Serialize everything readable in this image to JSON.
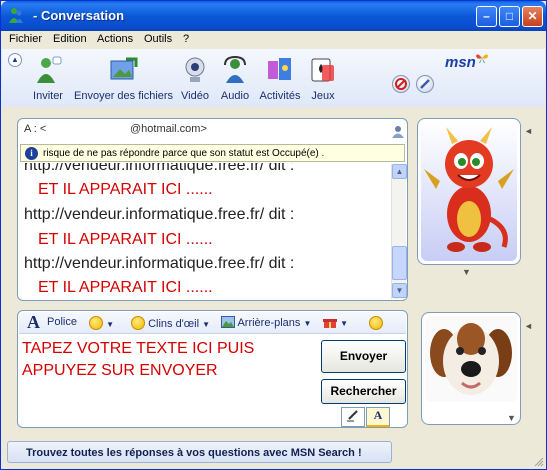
{
  "window": {
    "title": "- Conversation"
  },
  "menu": [
    "Fichier",
    "Edition",
    "Actions",
    "Outils",
    "?"
  ],
  "toolbar": {
    "items": [
      {
        "label": "Inviter",
        "icon": "invite-icon"
      },
      {
        "label": "Envoyer des fichiers",
        "icon": "send-files-icon"
      },
      {
        "label": "Vidéo",
        "icon": "video-icon"
      },
      {
        "label": "Audio",
        "icon": "audio-icon"
      },
      {
        "label": "Activités",
        "icon": "activities-icon"
      },
      {
        "label": "Jeux",
        "icon": "games-icon"
      }
    ],
    "brand": "msn"
  },
  "conversation": {
    "to_label": "A :  <",
    "to_value": "@hotmail.com>",
    "status_message": "risque de ne pas répondre parce que son statut est Occupé(e) .",
    "messages": [
      {
        "sender": "http://vendeur.informatique.free.fr/ dit :",
        "body": "ET IL APPARAIT ICI ......"
      },
      {
        "sender": "http://vendeur.informatique.free.fr/ dit :",
        "body": "ET IL APPARAIT ICI ......"
      },
      {
        "sender": "http://vendeur.informatique.free.fr/ dit :",
        "body": "ET IL APPARAIT ICI ......"
      }
    ]
  },
  "format_bar": {
    "font": "Police",
    "winks": "Clins d'œil",
    "backgrounds": "Arrière-plans"
  },
  "input": {
    "text": "TAPEZ VOTRE TEXTE ICI PUIS APPUYEZ SUR ENVOYER",
    "send_label": "Envoyer",
    "search_label": "Rechercher"
  },
  "bottom_bar": {
    "text": "Trouvez toutes les réponses à vos questions avec MSN Search !"
  },
  "colors": {
    "accent": "#0a58d6",
    "message_red": "#d50000",
    "status_bg": "#ffffe1"
  }
}
